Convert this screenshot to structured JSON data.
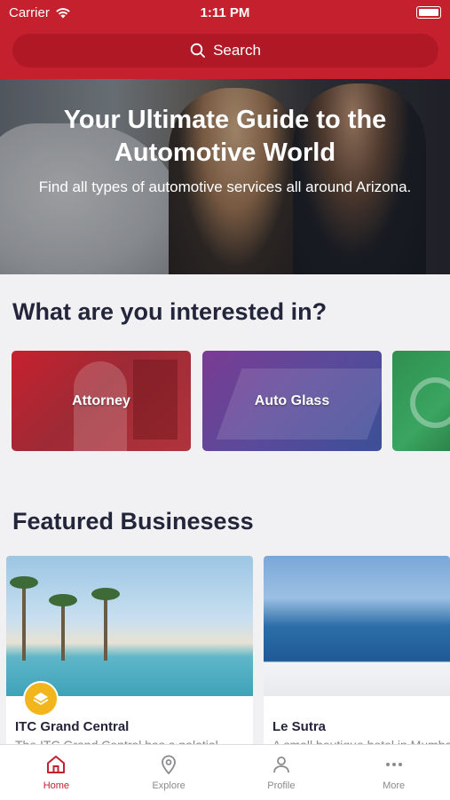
{
  "status_bar": {
    "carrier": "Carrier",
    "time": "1:11 PM"
  },
  "search": {
    "label": "Search"
  },
  "hero": {
    "title": "Your Ultimate Guide to the Automotive World",
    "subtitle": "Find all types of automotive services all around Arizona."
  },
  "interests": {
    "heading": "What are you interested in?",
    "categories": [
      {
        "label": "Attorney"
      },
      {
        "label": "Auto Glass"
      },
      {
        "label": ""
      }
    ]
  },
  "featured": {
    "heading": "Featured Businesess",
    "items": [
      {
        "name": "ITC Grand Central",
        "description": "The ITC Grand Central has a palatial"
      },
      {
        "name": "Le Sutra",
        "description": "A small boutique hotel in Mumbai"
      }
    ]
  },
  "tabbar": {
    "items": [
      {
        "label": "Home",
        "icon": "home-icon",
        "active": true
      },
      {
        "label": "Explore",
        "icon": "location-pin-icon"
      },
      {
        "label": "Profile",
        "icon": "user-icon"
      },
      {
        "label": "More",
        "icon": "more-dots-icon"
      }
    ]
  },
  "colors": {
    "brand": "#c4202e",
    "badge": "#f2b51b"
  }
}
